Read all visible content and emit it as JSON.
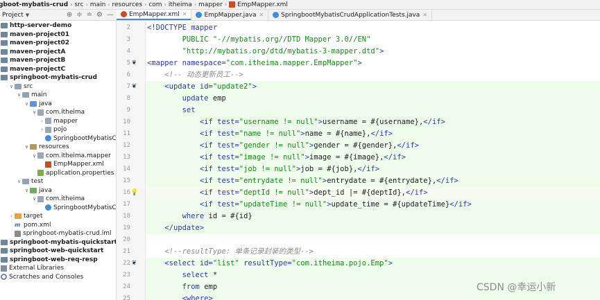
{
  "breadcrumb": {
    "items": [
      "gboot-mybatis-crud",
      "src",
      "main",
      "resources",
      "com",
      "itheima",
      "mapper",
      "EmpMapper.xml"
    ]
  },
  "project_panel": {
    "label": "Project"
  },
  "tabs": [
    {
      "label": "EmpMapper.xml",
      "active": true
    },
    {
      "label": "EmpMapper.java",
      "active": false
    },
    {
      "label": "SpringbootMybatisCrudApplicationTests.java",
      "active": false
    }
  ],
  "tree": [
    {
      "label": "http-server-demo",
      "depth": 0,
      "icon": "module-folder-icon",
      "bold": true
    },
    {
      "label": "maven-project01",
      "depth": 0,
      "icon": "module-folder-icon",
      "bold": true
    },
    {
      "label": "maven-project02",
      "depth": 0,
      "icon": "module-folder-icon",
      "bold": true
    },
    {
      "label": "maven-projectA",
      "depth": 0,
      "icon": "module-folder-icon",
      "bold": true
    },
    {
      "label": "maven-projectB",
      "depth": 0,
      "icon": "module-folder-icon",
      "bold": true
    },
    {
      "label": "maven-projectC",
      "depth": 0,
      "icon": "module-folder-icon",
      "bold": true
    },
    {
      "label": "springboot-mybatis-crud",
      "depth": 0,
      "icon": "module-folder-icon",
      "bold": true
    },
    {
      "label": "src",
      "depth": 1,
      "icon": "folder-icon",
      "expanded": true
    },
    {
      "label": "main",
      "depth": 2,
      "icon": "folder-icon",
      "expanded": true
    },
    {
      "label": "java",
      "depth": 3,
      "icon": "source-folder-icon",
      "expanded": true
    },
    {
      "label": "com.itheima",
      "depth": 4,
      "icon": "package-icon",
      "expanded": true
    },
    {
      "label": "mapper",
      "depth": 5,
      "icon": "package-icon",
      "expanded": false
    },
    {
      "label": "pojo",
      "depth": 5,
      "icon": "package-icon",
      "expanded": false
    },
    {
      "label": "SpringbootMybatisCrudAp",
      "depth": 5,
      "icon": "class-icon"
    },
    {
      "label": "resources",
      "depth": 3,
      "icon": "resources-folder-icon",
      "expanded": true
    },
    {
      "label": "com.itheima.mapper",
      "depth": 4,
      "icon": "package-icon",
      "expanded": true
    },
    {
      "label": "EmpMapper.xml",
      "depth": 5,
      "icon": "xml-file-icon"
    },
    {
      "label": "application.properties",
      "depth": 4,
      "icon": "properties-file-icon"
    },
    {
      "label": "test",
      "depth": 2,
      "icon": "folder-icon",
      "expanded": true
    },
    {
      "label": "java",
      "depth": 3,
      "icon": "test-folder-icon",
      "expanded": true
    },
    {
      "label": "com.itheima",
      "depth": 4,
      "icon": "package-icon",
      "expanded": true
    },
    {
      "label": "SpringbootMybatisCrudAp",
      "depth": 5,
      "icon": "class-icon"
    },
    {
      "label": "target",
      "depth": 1,
      "icon": "target-folder-icon",
      "expanded": false
    },
    {
      "label": "pom.xml",
      "depth": 1,
      "icon": "maven-pom-icon"
    },
    {
      "label": "springboot-mybatis-crud.iml",
      "depth": 1,
      "icon": "iml-file-icon"
    },
    {
      "label": "springboot-mybatis-quickstart",
      "depth": 0,
      "icon": "module-folder-icon",
      "bold": true
    },
    {
      "label": "springboot-web-quickstart",
      "depth": 0,
      "icon": "module-folder-icon",
      "bold": true
    },
    {
      "label": "springboot-web-req-resp",
      "depth": 0,
      "icon": "module-folder-icon",
      "bold": true
    },
    {
      "label": "External Libraries",
      "depth": 0,
      "icon": "libraries-icon"
    },
    {
      "label": "Scratches and Consoles",
      "depth": 0,
      "icon": "scratches-icon"
    }
  ],
  "gutter": {
    "line_numbers": [
      "2",
      "3",
      "4",
      "5",
      "6",
      "7",
      "8",
      "9",
      "10",
      "11",
      "12",
      "13",
      "14",
      "15",
      "16",
      "17",
      "18",
      "19",
      "20",
      "21",
      "22",
      "23",
      "24",
      "25"
    ]
  },
  "editor": {
    "lines": [
      [
        {
          "c": "t-tag",
          "t": "<!DOCTYPE mapper"
        }
      ],
      [
        {
          "c": "t-txt",
          "t": "        "
        },
        {
          "c": "t-val",
          "t": "PUBLIC \"-//mybatis.org//DTD Mapper 3.0//EN\""
        }
      ],
      [
        {
          "c": "t-txt",
          "t": "        "
        },
        {
          "c": "t-val",
          "t": "\"http://mybatis.org/dtd/mybatis-3-mapper.dtd\""
        },
        {
          "c": "t-tag",
          "t": ">"
        }
      ],
      [
        {
          "c": "t-tag",
          "t": "<mapper "
        },
        {
          "c": "t-attr",
          "t": "namespace="
        },
        {
          "c": "t-val",
          "t": "\"com.itheima.mapper.EmpMapper\""
        },
        {
          "c": "t-tag",
          "t": ">"
        }
      ],
      [
        {
          "c": "t-txt",
          "t": "    "
        },
        {
          "c": "t-cmt",
          "t": "<!-- 动态更新员工-->"
        }
      ],
      [
        {
          "c": "t-txt",
          "t": "    "
        },
        {
          "c": "t-tag",
          "t": "<update "
        },
        {
          "c": "t-attr",
          "t": "id="
        },
        {
          "c": "t-val",
          "t": "\"update2\""
        },
        {
          "c": "t-tag",
          "t": ">"
        }
      ],
      [
        {
          "c": "t-txt",
          "t": "        "
        },
        {
          "c": "t-kw",
          "t": "update"
        },
        {
          "c": "t-txt",
          "t": " emp"
        }
      ],
      [
        {
          "c": "t-txt",
          "t": "        "
        },
        {
          "c": "t-kw",
          "t": "set"
        }
      ],
      [
        {
          "c": "t-txt",
          "t": "            "
        },
        {
          "c": "t-tag",
          "t": "<if "
        },
        {
          "c": "t-attr",
          "t": "test="
        },
        {
          "c": "t-val",
          "t": "\"username != null\""
        },
        {
          "c": "t-tag",
          "t": ">"
        },
        {
          "c": "t-txt",
          "t": "username = #{username},"
        },
        {
          "c": "t-tag",
          "t": "</if>"
        }
      ],
      [
        {
          "c": "t-txt",
          "t": "            "
        },
        {
          "c": "t-tag",
          "t": "<if "
        },
        {
          "c": "t-attr",
          "t": "test="
        },
        {
          "c": "t-val",
          "t": "\"name != null\""
        },
        {
          "c": "t-tag",
          "t": ">"
        },
        {
          "c": "t-txt",
          "t": "name = #{name},"
        },
        {
          "c": "t-tag",
          "t": "</if>"
        }
      ],
      [
        {
          "c": "t-txt",
          "t": "            "
        },
        {
          "c": "t-tag",
          "t": "<if "
        },
        {
          "c": "t-attr",
          "t": "test="
        },
        {
          "c": "t-val",
          "t": "\"gender != null\""
        },
        {
          "c": "t-tag",
          "t": ">"
        },
        {
          "c": "t-txt",
          "t": "gender = #{gender},"
        },
        {
          "c": "t-tag",
          "t": "</if>"
        }
      ],
      [
        {
          "c": "t-txt",
          "t": "            "
        },
        {
          "c": "t-tag",
          "t": "<if "
        },
        {
          "c": "t-attr",
          "t": "test="
        },
        {
          "c": "t-val",
          "t": "\"image != null\""
        },
        {
          "c": "t-tag",
          "t": ">"
        },
        {
          "c": "t-txt",
          "t": "image = #{image},"
        },
        {
          "c": "t-tag",
          "t": "</if>"
        }
      ],
      [
        {
          "c": "t-txt",
          "t": "            "
        },
        {
          "c": "t-tag",
          "t": "<if "
        },
        {
          "c": "t-attr",
          "t": "test="
        },
        {
          "c": "t-val",
          "t": "\"job != null\""
        },
        {
          "c": "t-tag",
          "t": ">"
        },
        {
          "c": "t-txt",
          "t": "job = #{job},"
        },
        {
          "c": "t-tag",
          "t": "</if>"
        }
      ],
      [
        {
          "c": "t-txt",
          "t": "            "
        },
        {
          "c": "t-tag",
          "t": "<if "
        },
        {
          "c": "t-attr",
          "t": "test="
        },
        {
          "c": "t-val",
          "t": "\"entrydate != null\""
        },
        {
          "c": "t-tag",
          "t": ">"
        },
        {
          "c": "t-txt",
          "t": "entrydate = #{entrydate},"
        },
        {
          "c": "t-tag",
          "t": "</if>"
        }
      ],
      [
        {
          "c": "t-txt",
          "t": "            "
        },
        {
          "c": "t-tag",
          "t": "<if "
        },
        {
          "c": "t-attr",
          "t": "test="
        },
        {
          "c": "t-val",
          "t": "\"deptId != null\""
        },
        {
          "c": "t-tag",
          "t": ">"
        },
        {
          "c": "t-txt",
          "t": "dept_id |= #{deptId},"
        },
        {
          "c": "t-tag",
          "t": "</if>"
        }
      ],
      [
        {
          "c": "t-txt",
          "t": "            "
        },
        {
          "c": "t-tag",
          "t": "<if "
        },
        {
          "c": "t-attr",
          "t": "test="
        },
        {
          "c": "t-val",
          "t": "\"updateTime != null\""
        },
        {
          "c": "t-tag",
          "t": ">"
        },
        {
          "c": "t-txt",
          "t": "update_time = #{updateTime}"
        },
        {
          "c": "t-tag",
          "t": "</if>"
        }
      ],
      [
        {
          "c": "t-txt",
          "t": "        "
        },
        {
          "c": "t-kw",
          "t": "where"
        },
        {
          "c": "t-txt",
          "t": " id = #{id}"
        }
      ],
      [
        {
          "c": "t-txt",
          "t": "    "
        },
        {
          "c": "t-tag",
          "t": "</update>"
        }
      ],
      [
        {
          "c": "t-txt",
          "t": ""
        }
      ],
      [
        {
          "c": "t-txt",
          "t": "    "
        },
        {
          "c": "t-cmt",
          "t": "<!--resultType: 单条记录封装的类型-->"
        }
      ],
      [
        {
          "c": "t-txt",
          "t": "    "
        },
        {
          "c": "t-tag",
          "t": "<select "
        },
        {
          "c": "t-attr",
          "t": "id="
        },
        {
          "c": "t-val",
          "t": "\"list\""
        },
        {
          "c": "t-attr",
          "t": " resultType="
        },
        {
          "c": "t-val",
          "t": "\"com.itheima.pojo.Emp\""
        },
        {
          "c": "t-tag",
          "t": ">"
        }
      ],
      [
        {
          "c": "t-txt",
          "t": "        "
        },
        {
          "c": "t-kw",
          "t": "select"
        },
        {
          "c": "t-txt",
          "t": " *"
        }
      ],
      [
        {
          "c": "t-txt",
          "t": "        "
        },
        {
          "c": "t-kw",
          "t": "from"
        },
        {
          "c": "t-txt",
          "t": " emp"
        }
      ],
      [
        {
          "c": "t-txt",
          "t": "        "
        },
        {
          "c": "t-tag",
          "t": "<where>"
        }
      ]
    ]
  },
  "watermark": "CSDN @幸运小新"
}
